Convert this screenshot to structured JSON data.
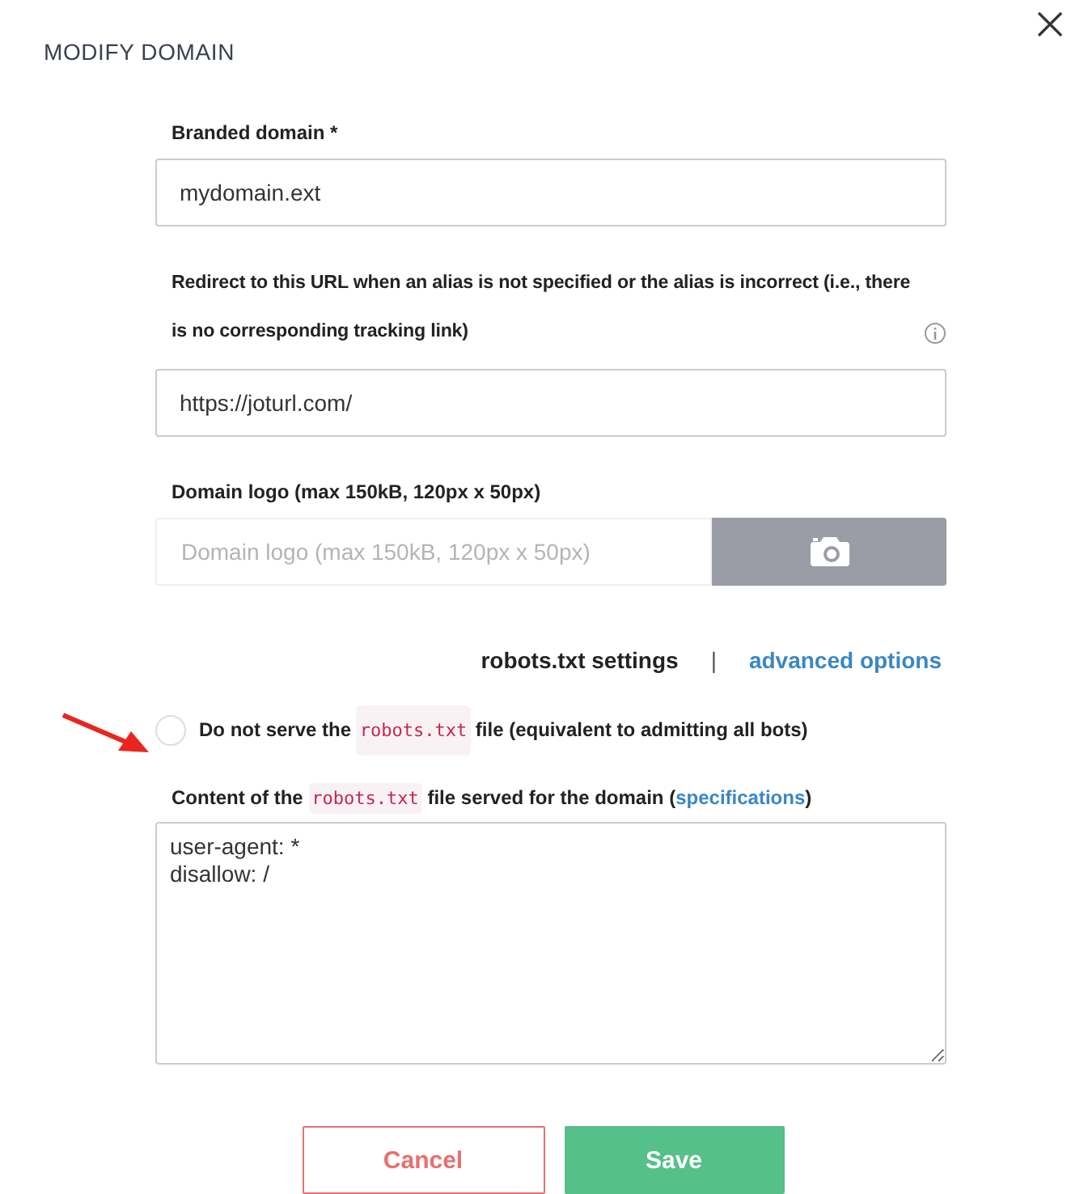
{
  "dialog": {
    "title": "MODIFY DOMAIN"
  },
  "branded_domain": {
    "label": "Branded domain *",
    "value": "mydomain.ext"
  },
  "redirect": {
    "label": "Redirect to this URL when an alias is not specified or the alias is incorrect (i.e., there is no corresponding tracking link)",
    "value": "https://joturl.com/"
  },
  "logo": {
    "label": "Domain logo (max 150kB, 120px x 50px)",
    "placeholder": "Domain logo (max 150kB, 120px x 50px)"
  },
  "tabs": [
    {
      "label": "robots.txt settings",
      "selected": true
    },
    {
      "label": "advanced options",
      "selected": false
    }
  ],
  "tab_separator": "|",
  "no_robots": {
    "text_before": "Do not serve the",
    "code": "robots.txt",
    "text_after": "file (equivalent to admitting all bots)",
    "checked": false
  },
  "content": {
    "text_before": "Content of the",
    "code": "robots.txt",
    "text_middle": "file served for the domain (",
    "link": "specifications",
    "text_after": ")",
    "value": "user-agent: *\ndisallow: /"
  },
  "buttons": [
    {
      "kind": "cancel",
      "label": "Cancel"
    },
    {
      "kind": "save",
      "label": "Save"
    }
  ]
}
